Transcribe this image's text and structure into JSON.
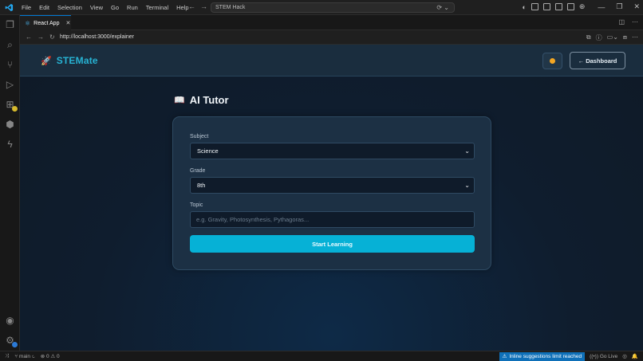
{
  "titlebar": {
    "menu": [
      "File",
      "Edit",
      "Selection",
      "View",
      "Go",
      "Run",
      "Terminal",
      "Help"
    ],
    "command_center": "STEM Hack"
  },
  "tab": {
    "label": "React App"
  },
  "browser": {
    "url": "http://localhost:3000/explainer"
  },
  "app": {
    "brand": "STEMate",
    "dashboard_button": "← Dashboard",
    "page_title": "AI Tutor",
    "form": {
      "subject_label": "Subject",
      "subject_value": "Science",
      "grade_label": "Grade",
      "grade_value": "8th",
      "topic_label": "Topic",
      "topic_placeholder": "e.g. Gravity, Photosynthesis, Pythagoras...",
      "submit_label": "Start Learning"
    }
  },
  "statusbar": {
    "branch": "main",
    "problems": "⊗ 0 ⚠ 0",
    "inline_limit": "Inline suggestions limit reached",
    "go_live": "Go Live"
  },
  "colors": {
    "accent": "#06b1d6",
    "brand": "#27b3d4",
    "vscode_blue": "#0078d4"
  }
}
